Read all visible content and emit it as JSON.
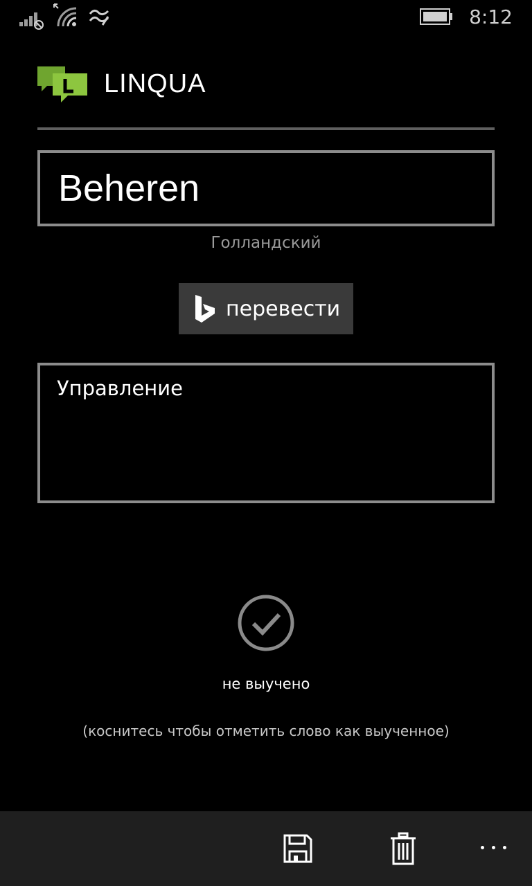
{
  "status_bar": {
    "time": "8:12",
    "icons": [
      "signal-no-sim-icon",
      "wifi-icon",
      "data-sense-icon",
      "battery-icon"
    ]
  },
  "app": {
    "title": "LINQUA",
    "logo_letter": "L",
    "logo_color": "#8dc63f"
  },
  "word": {
    "value": "Beheren",
    "language": "Голландский"
  },
  "translate_button": {
    "label": "перевести",
    "icon": "bing-icon"
  },
  "translation": {
    "value": "Управление"
  },
  "learned": {
    "icon": "checkmark-circle-icon",
    "status": "не выучено",
    "hint": "(коснитесь чтобы отметить слово как выученное)"
  },
  "app_bar": {
    "buttons": [
      "save-icon",
      "delete-icon"
    ],
    "more": "more-icon"
  }
}
